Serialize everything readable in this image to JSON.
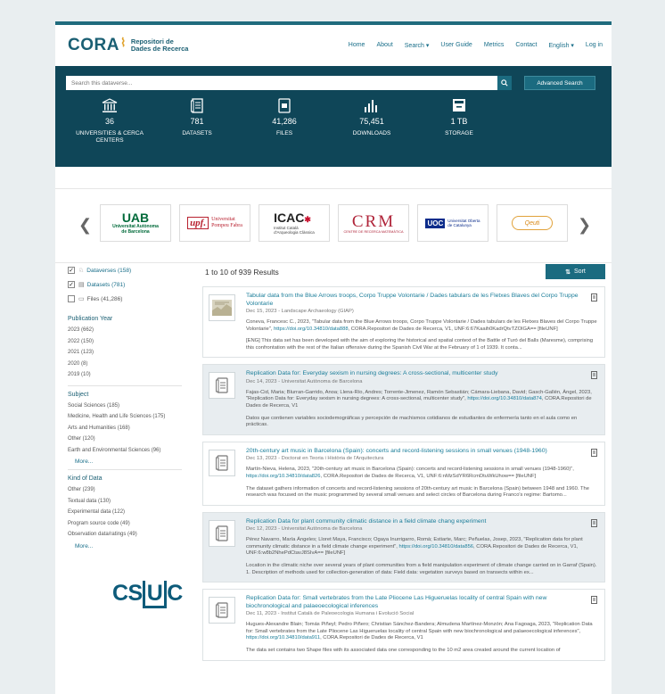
{
  "brand": {
    "logo": "CORA",
    "name_line1": "Repositori de",
    "name_line2": "Dades de Recerca"
  },
  "nav": [
    "Home",
    "About",
    "Search ▾",
    "User Guide",
    "Metrics",
    "Contact",
    "English ▾",
    "Log in"
  ],
  "search": {
    "placeholder": "Search this dataverse...",
    "advanced_label": "Advanced Search"
  },
  "metrics": [
    {
      "icon": "institution-icon",
      "value": "36",
      "label_line1": "UNIVERSITIES & CERCA",
      "label_line2": "CENTERS"
    },
    {
      "icon": "datasets-icon",
      "value": "781",
      "label_line1": "DATASETS",
      "label_line2": ""
    },
    {
      "icon": "files-icon",
      "value": "41,286",
      "label_line1": "FILES",
      "label_line2": ""
    },
    {
      "icon": "downloads-icon",
      "value": "75,451",
      "label_line1": "DOWNLOADS",
      "label_line2": ""
    },
    {
      "icon": "storage-icon",
      "value": "1 TB",
      "label_line1": "STORAGE",
      "label_line2": ""
    }
  ],
  "partners": [
    {
      "line1": "UAB",
      "line2": "Universitat Autònoma",
      "line3": "de Barcelona",
      "color": "#006a3a"
    },
    {
      "line1": "upf.",
      "line2": "Universitat",
      "line3": "Pompeu Fabra",
      "color": "#b8212f"
    },
    {
      "line1": "ICAC",
      "line2": "Institut Català",
      "line3": "d'Arqueologia Clàssica",
      "color": "#c8102e"
    },
    {
      "line1": "CRM",
      "line2": "CENTRE DE RECERCA MATEMÀTICA",
      "line3": "",
      "color": "#b0253a"
    },
    {
      "line1": "UOC",
      "line2": "Universitat Oberta",
      "line3": "de Catalunya",
      "color": "#0b2c8b"
    },
    {
      "line1": "Qeuti",
      "line2": "",
      "line3": "",
      "color": "#d98a1a"
    }
  ],
  "facets": {
    "types": [
      {
        "label": "Dataverses (158)",
        "checked": "✓",
        "icon": "dataverse-icon"
      },
      {
        "label": "Datasets (781)",
        "checked": "✓",
        "icon": "dataset-icon"
      },
      {
        "label": "Files (41,286)",
        "checked": "",
        "icon": "file-icon"
      }
    ],
    "publication_year": {
      "title": "Publication Year",
      "items": [
        "2023 (662)",
        "2022 (150)",
        "2021 (123)",
        "2020 (8)",
        "2019 (10)"
      ]
    },
    "subject": {
      "title": "Subject",
      "items": [
        "Social Sciences (185)",
        "Medicine, Health and Life Sciences (175)",
        "Arts and Humanities (168)",
        "Other (120)",
        "Earth and Environmental Sciences (96)"
      ],
      "more": "More..."
    },
    "kind_of_data": {
      "title": "Kind of Data",
      "items": [
        "Other (239)",
        "Textual data (130)",
        "Experimental data (122)",
        "Program source code (49)",
        "Observation data/ratings (49)"
      ],
      "more": "More..."
    }
  },
  "footer_logo": {
    "pre": "CS",
    "mid": "U",
    "post": "C"
  },
  "results": {
    "count": "1 to 10 of 939 Results",
    "sort_label": "Sort",
    "items": [
      {
        "title": "Tabular data from the Blue Arrows troops, Corpo Truppe Volontarie / Dades tabulars de les Fletxes Blaves del Corpo Truppe Volontarie",
        "meta": "Dec 15, 2023 - Landscape Archaeology (GIAP)",
        "cite": "Coneva, Francesc C., 2023, \"Tabular data from the Blue Arrows troops, Corpo Truppe Volontarie / Dades tabulars de les Fletxes Blaves del Corpo Truppe Volontarie\",",
        "cite_link": "https://doi.org/10.34810/data888",
        "cite_tail": ", CORA.Repositori de Dades de Recerca, V1, UNF:6:67Kaaih0KadrQtvTZOlGA== [fileUNF]",
        "desc": "[ENG] This data set has been developed with the aim of exploring the historical and spatial context of the Battle of Turó del Balls (Maresme), comprising this confrontation with the rest of the Italian offensive during the Spanish Civil War at the February of 1 of 1939. It conta...",
        "shaded": false,
        "thumb": "map"
      },
      {
        "title": "Replication Data for: Everyday sexism in nursing degrees: A cross-sectional, multicenter study",
        "meta": "Dec 14, 2023 - Universitat Autònoma de Barcelona",
        "cite": "Fajas-Cid, Maria; Blurran-Garrido, Anoa; Llena-Río, Andres; Torrente-Jimenez, Ramón Sebastián; Cámara-Liebana, David; Gasch-Gallén, Àngel, 2023, \"Replication Data for: Everyday sexism in nursing degrees: A cross-sectional, multicenter study\",",
        "cite_link": "https://doi.org/10.34810/data874",
        "cite_tail": ", CORA.Repositori de Dades de Recerca, V1",
        "desc": "Datos que contienen variables sociodemográficas y percepción de machismos cotidianos de estudiantes de enfermería tanto en el aula como en prácticas.",
        "shaded": true,
        "thumb": "doc"
      },
      {
        "title": "20th-century art music in Barcelona (Spain): concerts and record-listening sessions in small venues (1948-1960)",
        "meta": "Dec 13, 2023 - Doctorat en Teoria i Història de l'Arquitectura",
        "cite": "Martín-Nieva, Helena, 2023, \"20th-century art music in Barcelona (Spain): concerts and record-listening sessions in small venues (1948-1960)\",",
        "cite_link": "https://doi.org/10.34810/data826",
        "cite_tail": ", CORA.Repositori de Dades de Recerca, V1, UNF:6:nMzSdYR6RcmDtuWkUhow== [fileUNF]",
        "desc": "The dataset gathers information of concerts and record-listening sessions of 20th-century art music in Barcelona (Spain) between 1948 and 1960. The research was focused on the music programmed by several small venues and select circles of Barcelona during Franco's regime: Bartomo...",
        "shaded": false,
        "thumb": "doc"
      },
      {
        "title": "Replication Data for plant community climatic distance in a field climate chang experiment",
        "meta": "Dec 12, 2023 - Universitat Autònoma de Barcelona",
        "cite": "Pérez Navarro, María Ángeles; Lloret Maya, Francisco; Ogaya Inurrigarro, Romà; Estiarte, Marc; Peñuelas, Josep, 2023, \"Replication data for plant community climatic distance in a field climate change experiment\",",
        "cite_link": "https://doi.org/10.34810/data856",
        "cite_tail": ", CORA.Repositori de Dades de Recerca, V1, UNF:6:w8b2NhePdCtavJ8SIvA== [fileUNF]",
        "desc": "Location in the climatic niche over several years of plant communities from a field manipulation experiment of climate change carried on in Garraf (Spain). 1. Description of methods used for collection-generation of data: Field data: vegetation surveys based on transects within ex...",
        "shaded": true,
        "thumb": "doc"
      },
      {
        "title": "Replication Data for: Small vertebrates from the Late Pliocene Las Higueruelas locality of central Spain with new biochronological and palaeoecological inferences",
        "meta": "Dec 11, 2023 - Institut Català de Paleoecologia Humana i Evolució Social",
        "cite": "Hugues-Alexandre Blain; Tomás Piñeyl; Pedro Piñero; Christian Sánchez-Bandera; Almudena Martínez-Monzón; Ana Fagoaga, 2023, \"Replication Data for: Small vertebrates from the Late Pliocene Las Higueruelas locality of central Spain with new biochronological and palaeoecological inferences\",",
        "cite_link": "https://doi.org/10.34810/data911",
        "cite_tail": ", CORA.Repositori de Dades de Recerca, V1",
        "desc": "The data set contains two Shape files with its associated data one corresponding to the 10 m2 area created around the current location of",
        "shaded": false,
        "thumb": "doc"
      }
    ]
  }
}
